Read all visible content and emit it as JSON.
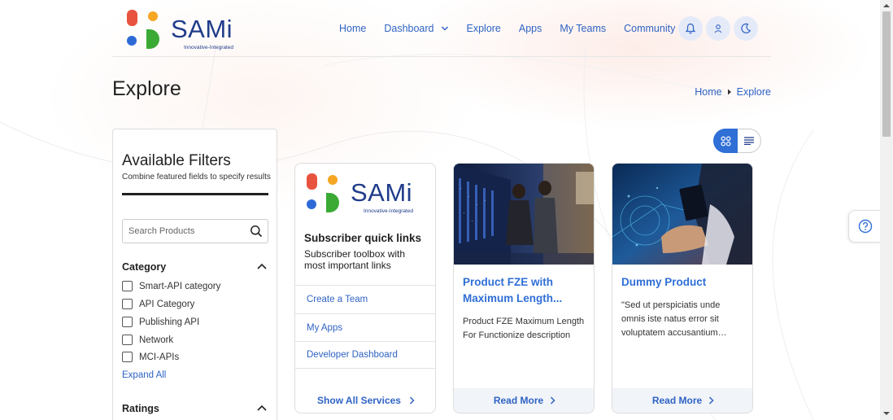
{
  "brand": {
    "name": "SAMi",
    "tagline": "Innovative-Integrated",
    "colors": {
      "red": "#e8533f",
      "orange": "#f5a623",
      "blue": "#2d6ad8",
      "green": "#3aaa35",
      "text": "#1f3c8a"
    }
  },
  "nav": {
    "items": [
      {
        "label": "Home",
        "has_dropdown": false
      },
      {
        "label": "Dashboard",
        "has_dropdown": true
      },
      {
        "label": "Explore",
        "has_dropdown": false
      },
      {
        "label": "Apps",
        "has_dropdown": false
      },
      {
        "label": "My Teams",
        "has_dropdown": false
      },
      {
        "label": "Community",
        "has_dropdown": true
      }
    ],
    "icons": [
      "bell-icon",
      "user-icon",
      "moon-icon"
    ]
  },
  "page": {
    "title": "Explore",
    "breadcrumb": [
      "Home",
      "Explore"
    ]
  },
  "filters": {
    "title": "Available Filters",
    "subtitle": "Combine featured fields to specify results",
    "search_placeholder": "Search Products",
    "category": {
      "heading": "Category",
      "items": [
        "Smart-API category",
        "API Category",
        "Publishing API",
        "Network",
        "MCI-APIs"
      ],
      "expand_label": "Expand All"
    },
    "ratings": {
      "heading": "Ratings"
    }
  },
  "view_toggle": {
    "active": "grid"
  },
  "quick_links": {
    "title": "Subscriber quick links",
    "subtitle": "Subscriber toolbox with most important links",
    "links": [
      "Create a Team",
      "My Apps",
      "Developer Dashboard"
    ],
    "footer": "Show All Services"
  },
  "products": [
    {
      "title": "Product FZE with Maximum Length...",
      "description": "Product FZE Maximum Length For Functionize description",
      "cta": "Read More"
    },
    {
      "title": "Dummy Product",
      "description": "\"Sed ut perspiciatis unde omnis iste natus error sit voluptatem accusantium…",
      "cta": "Read More"
    }
  ],
  "accent": {
    "link": "#2f63c4",
    "primary": "#2f6fd6"
  }
}
